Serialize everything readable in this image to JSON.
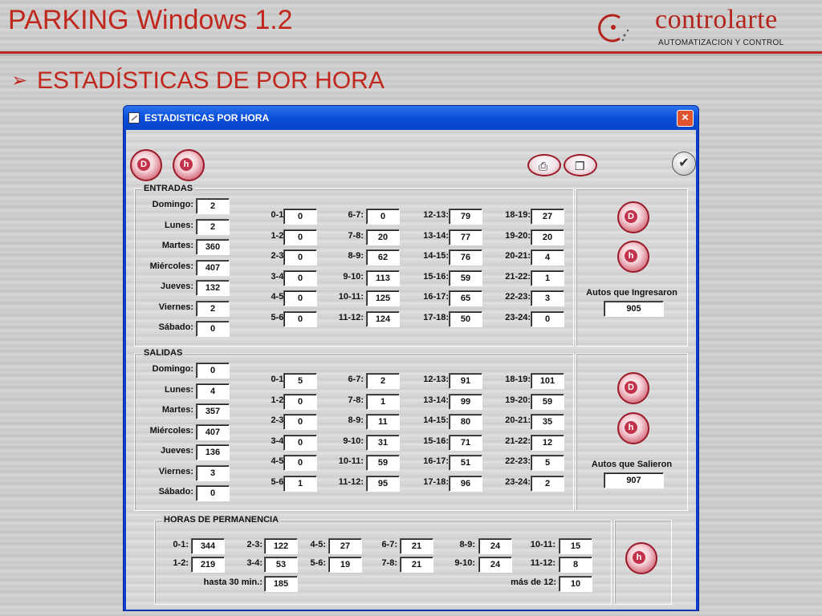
{
  "slide": {
    "title": "PARKING Windows 1.2",
    "logo_name": "controlarte",
    "logo_tagline": "AUTOMATIZACION Y CONTROL",
    "subtitle": "ESTADÍSTICAS DE POR HORA"
  },
  "colors": {
    "accent": "#c0281e",
    "titlebar": "#0a4fd8",
    "close": "#e0532f",
    "round_button": "#c2324a"
  },
  "window": {
    "title": "ESTADISTICAS POR HORA",
    "close_glyph": "×",
    "toolbar": {
      "day_button": "D",
      "hour_button": "h",
      "print_icon": "printer-icon",
      "copy_icon": "copy-icon",
      "accept_icon": "checkmark-icon"
    }
  },
  "days": [
    "Domingo:",
    "Lunes:",
    "Martes:",
    "Miércoles:",
    "Jueves:",
    "Viernes:",
    "Sábado:"
  ],
  "hour_labels": [
    "0-1:",
    "1-2:",
    "2-3:",
    "3-4:",
    "4-5:",
    "5-6:",
    "6-7:",
    "7-8:",
    "8-9:",
    "9-10:",
    "10-11:",
    "11-12:",
    "12-13:",
    "13-14:",
    "14-15:",
    "15-16:",
    "16-17:",
    "17-18:",
    "18-19:",
    "19-20:",
    "20-21:",
    "21-22:",
    "22-23:",
    "23-24:"
  ],
  "entradas": {
    "title": "ENTRADAS",
    "days": [
      "2",
      "2",
      "360",
      "407",
      "132",
      "2",
      "0"
    ],
    "hours": [
      "0",
      "0",
      "0",
      "0",
      "0",
      "0",
      "0",
      "20",
      "62",
      "113",
      "125",
      "124",
      "79",
      "77",
      "76",
      "59",
      "65",
      "50",
      "27",
      "20",
      "4",
      "1",
      "3",
      "0"
    ],
    "total_label": "Autos que Ingresaron",
    "total": "905"
  },
  "salidas": {
    "title": "SALIDAS",
    "days": [
      "0",
      "4",
      "357",
      "407",
      "136",
      "3",
      "0"
    ],
    "hours": [
      "5",
      "0",
      "0",
      "0",
      "0",
      "1",
      "2",
      "1",
      "11",
      "31",
      "59",
      "95",
      "91",
      "99",
      "80",
      "71",
      "51",
      "96",
      "101",
      "59",
      "35",
      "12",
      "5",
      "2"
    ],
    "total_label": "Autos que Salieron",
    "total": "907"
  },
  "permanencia": {
    "title": "HORAS DE PERMANENCIA",
    "labels": [
      "0-1:",
      "2-3:",
      "4-5:",
      "6-7:",
      "8-9:",
      "10-11:",
      "1-2:",
      "3-4:",
      "5-6:",
      "7-8:",
      "9-10:",
      "11-12:"
    ],
    "values": [
      "344",
      "122",
      "27",
      "21",
      "24",
      "15",
      "219",
      "53",
      "19",
      "21",
      "24",
      "8"
    ],
    "hasta_label": "hasta 30 min.:",
    "hasta_value": "185",
    "mas_label": "más de 12:",
    "mas_value": "10"
  }
}
